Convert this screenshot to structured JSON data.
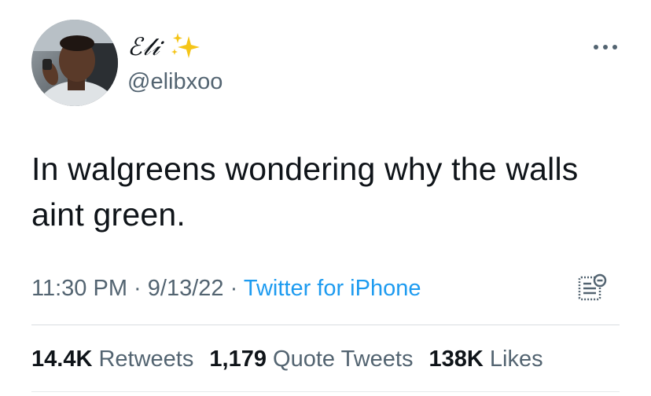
{
  "user": {
    "display_name": "ℰ𝓁𝒾",
    "handle": "@elibxoo",
    "name_decoration_icon": "sparkles-icon",
    "avatar_icon": "user-avatar-photo"
  },
  "tweet": {
    "text_line1": "In walgreens wondering why the walls",
    "text_line2": "aint green."
  },
  "meta": {
    "time": "11:30 PM",
    "separator": "·",
    "date": "9/13/22",
    "source": "Twitter for iPhone"
  },
  "stats": {
    "retweets_count": "14.4K",
    "retweets_label": "Retweets",
    "quotes_count": "1,179",
    "quotes_label": "Quote Tweets",
    "likes_count": "138K",
    "likes_label": "Likes"
  },
  "icons": {
    "more": "more-horizontal-icon",
    "analytics": "analytics-icon"
  },
  "colors": {
    "text_primary": "#0f1419",
    "text_secondary": "#536471",
    "link": "#1d9bf0",
    "sparkle": "#f5c518",
    "divider": "#d9dde0"
  }
}
